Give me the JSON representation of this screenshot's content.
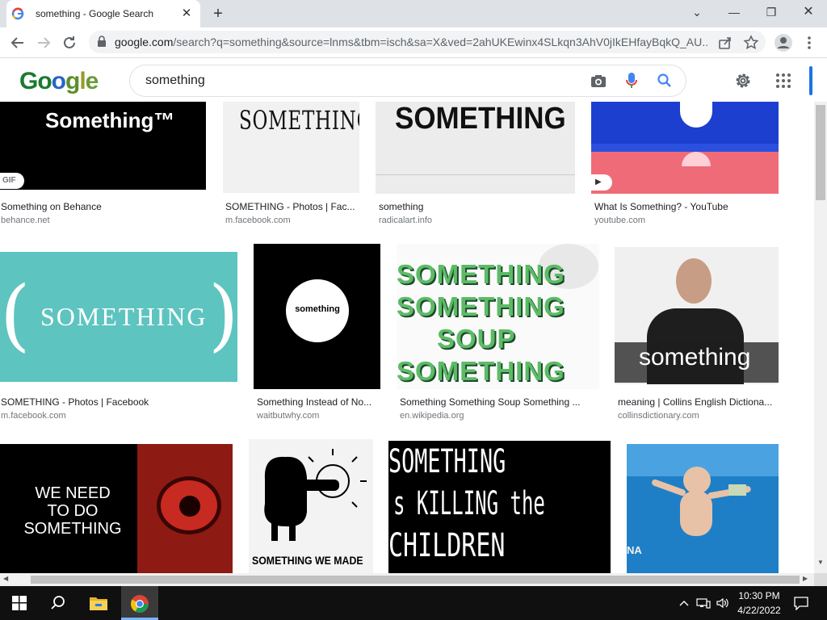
{
  "tab": {
    "title": "something - Google Search",
    "close": "✕",
    "new_tab": "+"
  },
  "window": {
    "dropdown": "⌄",
    "minimize": "—",
    "restore": "❐",
    "close": "✕"
  },
  "toolbar": {
    "url_host": "google.com",
    "url_rest": "/search?q=something&source=lnms&tbm=isch&sa=X&ved=2ahUKEwinx4SLkqn3AhV0jIkEHfayBqkQ_AU..."
  },
  "google": {
    "logo_letters": [
      {
        "ch": "G",
        "color": "#1a7a2e"
      },
      {
        "ch": "o",
        "color": "#1a7a2e"
      },
      {
        "ch": "o",
        "color": "#2a63c9"
      },
      {
        "ch": "g",
        "color": "#5b8f2a"
      },
      {
        "ch": "l",
        "color": "#9a9a2a"
      },
      {
        "ch": "e",
        "color": "#6a9a3a"
      }
    ],
    "query": "something"
  },
  "results": [
    {
      "title": "Something on Behance",
      "site": "behance.net",
      "thumb_text": "Something™",
      "badge": "GIF"
    },
    {
      "title": "SOMETHING - Photos | Fac...",
      "site": "m.facebook.com",
      "thumb_text": "SOMETHING."
    },
    {
      "title": "something",
      "site": "radicalart.info",
      "thumb_text": "SOMETHING"
    },
    {
      "title": "What Is Something? - YouTube",
      "site": "youtube.com",
      "badge": "▶"
    },
    {
      "title": "SOMETHING - Photos | Facebook",
      "site": "m.facebook.com",
      "thumb_text": "SOMETHING",
      "paren_left": "(",
      "paren_right": ")"
    },
    {
      "title": "Something Instead of No...",
      "site": "waitbutwhy.com",
      "thumb_text": "something"
    },
    {
      "title": "Something Something Soup Something ...",
      "site": "en.wikipedia.org",
      "thumb_lines": [
        "SOMETHING",
        "SOMETHING",
        "SOUP",
        "SOMETHING"
      ]
    },
    {
      "title": "meaning | Collins English Dictiona...",
      "site": "collinsdictionary.com",
      "thumb_text": "something"
    },
    {
      "thumb_lines": [
        "WE NEED",
        "TO DO",
        "SOMETHING"
      ]
    },
    {
      "thumb_text": "SOMETHING WE MADE"
    },
    {
      "thumb_lines": [
        "SOMETHING",
        "s KILLING the",
        "CHILDREN"
      ]
    },
    {
      "thumb_text": "NA"
    }
  ],
  "taskbar": {
    "time": "10:30 PM",
    "date": "4/22/2022"
  }
}
